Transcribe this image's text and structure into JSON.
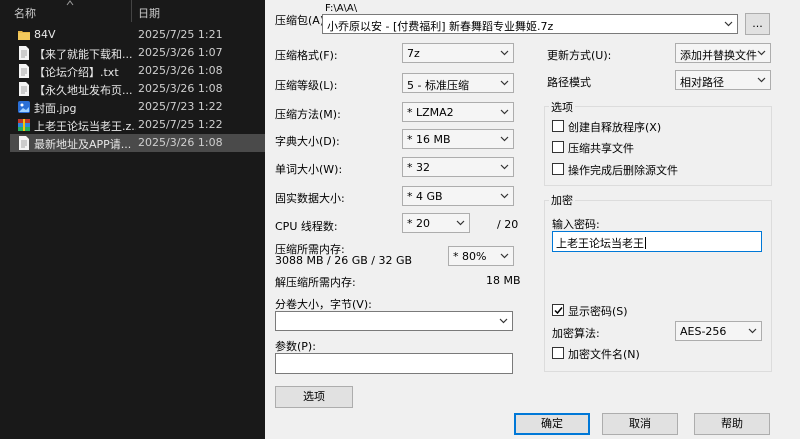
{
  "explorer": {
    "header": {
      "name": "名称",
      "date": "日期"
    },
    "files": [
      {
        "name": "84V",
        "date": "2025/7/25 1:21",
        "icon": "folder-icon",
        "selected": false
      },
      {
        "name": "【来了就能下载和...",
        "date": "2025/3/26 1:07",
        "icon": "text-file-icon",
        "selected": false
      },
      {
        "name": "【论坛介绍】.txt",
        "date": "2025/3/26 1:08",
        "icon": "text-file-icon",
        "selected": false
      },
      {
        "name": "【永久地址发布页...",
        "date": "2025/3/26 1:08",
        "icon": "text-file-icon",
        "selected": false
      },
      {
        "name": "封面.jpg",
        "date": "2025/7/23 1:22",
        "icon": "image-file-icon",
        "selected": false
      },
      {
        "name": "上老王论坛当老王.z...",
        "date": "2025/7/25 1:22",
        "icon": "archive-file-icon",
        "selected": false
      },
      {
        "name": "最新地址及APP请...",
        "date": "2025/3/26 1:08",
        "icon": "text-file-icon",
        "selected": true
      }
    ]
  },
  "dialog": {
    "archive": {
      "label": "压缩包(A)",
      "path": "F:\\A\\A\\",
      "value": "小乔原以安 - [付费福利] 新春舞蹈专业舞姬.7z",
      "browse": "..."
    },
    "left": {
      "format": {
        "label": "压缩格式(F):",
        "value": "7z"
      },
      "level": {
        "label": "压缩等级(L):",
        "value": "5 - 标准压缩"
      },
      "method": {
        "label": "压缩方法(M):",
        "value": "* LZMA2"
      },
      "dict": {
        "label": "字典大小(D):",
        "value": "* 16 MB"
      },
      "word": {
        "label": "单词大小(W):",
        "value": "* 32"
      },
      "solid": {
        "label": "固实数据大小:",
        "value": "* 4 GB"
      },
      "threads": {
        "label": "CPU 线程数:",
        "value": "* 20",
        "max": "/ 20"
      },
      "mem_compress": {
        "label": "压缩所需内存:",
        "value": "3088 MB / 26 GB / 32 GB",
        "percent": "* 80%"
      },
      "mem_decompress": {
        "label": "解压缩所需内存:",
        "value": "18 MB"
      },
      "split": {
        "label": "分卷大小，字节(V):",
        "value": ""
      },
      "params": {
        "label": "参数(P):",
        "value": ""
      },
      "options_button": "选项"
    },
    "right": {
      "update": {
        "label": "更新方式(U):",
        "value": "添加并替换文件"
      },
      "path_mode": {
        "label": "路径模式",
        "value": "相对路径"
      },
      "options_group": {
        "title": "选项",
        "sfx": {
          "label": "创建自释放程序(X)",
          "checked": false
        },
        "shared": {
          "label": "压缩共享文件",
          "checked": false
        },
        "delete": {
          "label": "操作完成后删除源文件",
          "checked": false
        }
      },
      "encrypt_group": {
        "title": "加密",
        "password_label": "输入密码:",
        "password_value": "上老王论坛当老王",
        "show_password": {
          "label": "显示密码(S)",
          "checked": true
        },
        "algo_label": "加密算法:",
        "algo_value": "AES-256",
        "encrypt_names": {
          "label": "加密文件名(N)",
          "checked": false
        }
      }
    },
    "buttons": {
      "ok": "确定",
      "cancel": "取消",
      "help": "帮助"
    }
  }
}
